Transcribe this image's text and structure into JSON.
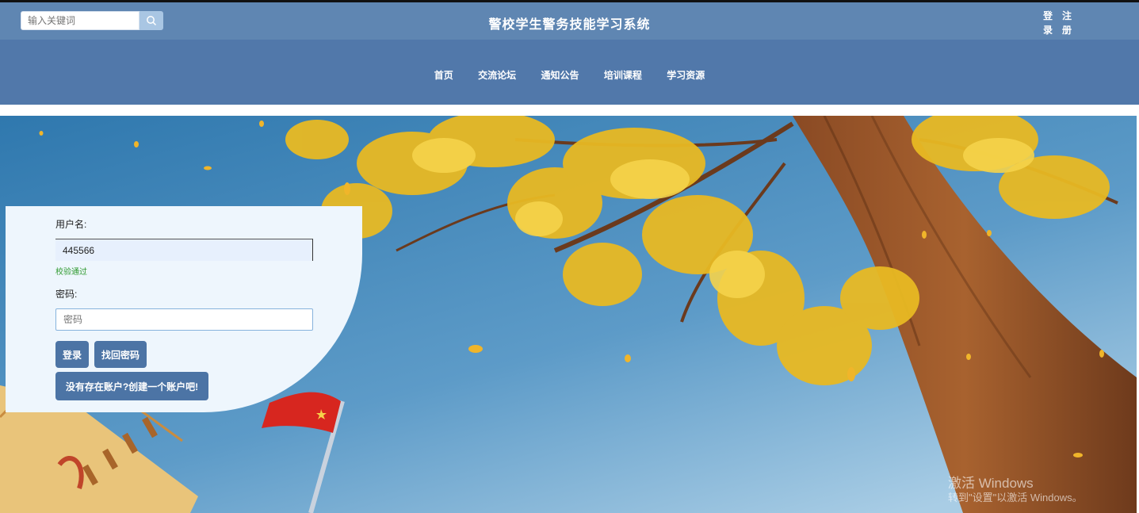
{
  "header": {
    "search_placeholder": "输入关键词",
    "title": "警校学生警务技能学习系统",
    "login_chars": [
      "登",
      "录"
    ],
    "register_chars": [
      "注",
      "册"
    ]
  },
  "nav": {
    "items": [
      "首页",
      "交流论坛",
      "通知公告",
      "培训课程",
      "学习资源"
    ]
  },
  "login_form": {
    "username_label": "用户名:",
    "username_value": "445566",
    "username_validation": "校验通过",
    "password_label": "密码:",
    "password_placeholder": "密码",
    "login_button": "登录",
    "forgot_button": "找回密码",
    "register_button": "没有存在账户?创建一个账户吧!"
  },
  "os_watermark": {
    "line1": "激活 Windows",
    "line2": "转到\"设置\"以激活 Windows。"
  },
  "colors": {
    "topbar": "#5f86b2",
    "navbar": "#5178aa",
    "button": "#4c74a5",
    "panel": "#eef6fd",
    "valid": "#2f9a2f"
  }
}
